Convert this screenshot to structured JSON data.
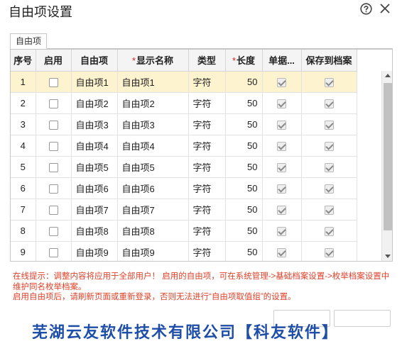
{
  "dialog": {
    "title": "自由项设置"
  },
  "tab": {
    "label": "自由项"
  },
  "table": {
    "columns": [
      "序号",
      "启用",
      "自由项",
      "显示名称",
      "类型",
      "长度",
      "单据...",
      "保存到档案"
    ],
    "rows": [
      {
        "no": "1",
        "enabled": false,
        "item": "自由项1",
        "name": "自由项1",
        "type": "字符",
        "length": "50",
        "doc": true,
        "save": true,
        "selected": true
      },
      {
        "no": "2",
        "enabled": false,
        "item": "自由项2",
        "name": "自由项2",
        "type": "字符",
        "length": "50",
        "doc": true,
        "save": true
      },
      {
        "no": "3",
        "enabled": false,
        "item": "自由项3",
        "name": "自由项3",
        "type": "字符",
        "length": "50",
        "doc": true,
        "save": true
      },
      {
        "no": "4",
        "enabled": false,
        "item": "自由项4",
        "name": "自由项4",
        "type": "字符",
        "length": "50",
        "doc": true,
        "save": true
      },
      {
        "no": "5",
        "enabled": false,
        "item": "自由项5",
        "name": "自由项5",
        "type": "字符",
        "length": "50",
        "doc": true,
        "save": true
      },
      {
        "no": "6",
        "enabled": false,
        "item": "自由项6",
        "name": "自由项6",
        "type": "字符",
        "length": "50",
        "doc": true,
        "save": true
      },
      {
        "no": "7",
        "enabled": false,
        "item": "自由项7",
        "name": "自由项7",
        "type": "字符",
        "length": "50",
        "doc": true,
        "save": true
      },
      {
        "no": "8",
        "enabled": false,
        "item": "自由项8",
        "name": "自由项8",
        "type": "字符",
        "length": "50",
        "doc": true,
        "save": true
      },
      {
        "no": "9",
        "enabled": false,
        "item": "自由项9",
        "name": "自由项9",
        "type": "字符",
        "length": "50",
        "doc": true,
        "save": true
      }
    ]
  },
  "notice": {
    "line1": "在线提示：调整内容将应用于全部用户！ 启用的自由项，可在系统管理->基础档案设置->枚举档案设置中维护同名枚举档案。",
    "line2": "启用自由项后，请刷新页面或重新登录，否则无法进行“自由项取值组”的设置。"
  },
  "watermark": "芜湖云友软件技术有限公司【科友软件】",
  "colors": {
    "notice": "#e0412a",
    "selected_row": "#fdf3cf",
    "watermark": "#1f4ea8"
  }
}
